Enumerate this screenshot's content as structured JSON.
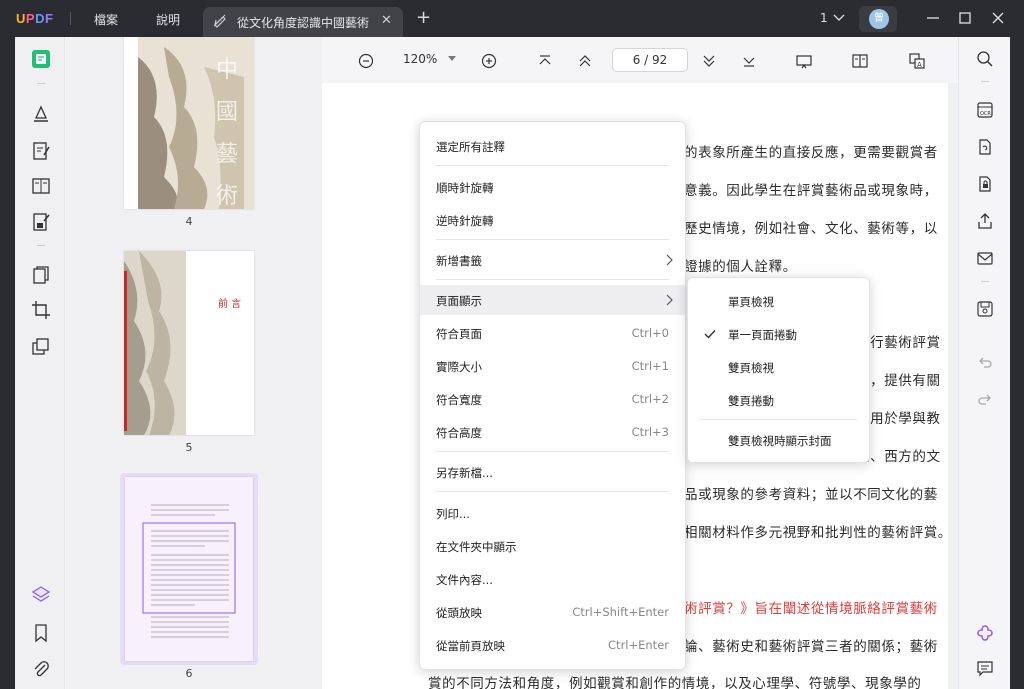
{
  "app": {
    "logo": [
      "U",
      "P",
      "D",
      "F"
    ]
  },
  "menubar": {
    "file": "檔案",
    "help": "說明"
  },
  "tab": {
    "title": "從文化角度認識中國藝術"
  },
  "window": {
    "count": "1",
    "avatar": "曾"
  },
  "toolbar": {
    "zoom": "120%",
    "page_current": "6",
    "page_total": "92",
    "page_display": "6  /  92"
  },
  "thumbnails": [
    {
      "page": "4",
      "title_text": "中國藝術"
    },
    {
      "page": "5",
      "title_text": "前言"
    },
    {
      "page": "6"
    }
  ],
  "document": {
    "lines": [
      {
        "text": "的表象所產生的直接反應，更需要觀賞者",
        "color": "#2b2b2b"
      },
      {
        "text": "意義。因此學生在評賞藝術品或現象時，",
        "color": "#2b2b2b"
      },
      {
        "text": "歷史情境，例如社會、文化、藝術等，以",
        "color": "#2b2b2b"
      },
      {
        "text": "證據的個人詮釋。",
        "color": "#2b2b2b"
      },
      {
        "text": "進行藝術評賞",
        "color": "#2b2b2b"
      },
      {
        "text": "文，提供有關",
        "color": "#2b2b2b"
      },
      {
        "text": "運用於學與教",
        "color": "#2b2b2b"
      },
      {
        "text": "地、西方的文",
        "color": "#2b2b2b"
      },
      {
        "text": "品或現象的參考資料；並以不同文化的藝",
        "color": "#2b2b2b"
      },
      {
        "text": "相關材料作多元視野和批判性的藝術評賞。",
        "color": "#2b2b2b"
      },
      {
        "text": "術評賞？》旨在闡述從情境脈絡評賞藝術",
        "color": "#e23b3b"
      },
      {
        "text": "論、藝術史和藝術評賞三者的關係；藝術",
        "color": "#2b2b2b"
      },
      {
        "text": "賞的不同方法和角度，例如觀賞和創作的情境，以及心理學、符號學、現象學的",
        "color": "#2b2b2b"
      }
    ]
  },
  "context_menu": {
    "items": [
      {
        "label": "選定所有註釋",
        "shortcut": ""
      },
      {
        "label": "順時針旋轉",
        "shortcut": ""
      },
      {
        "label": "逆時針旋轉",
        "shortcut": ""
      },
      {
        "label": "新增書籤",
        "shortcut": ""
      },
      {
        "label": "頁面顯示",
        "shortcut": ""
      },
      {
        "label": "符合頁面",
        "shortcut": "Ctrl+0"
      },
      {
        "label": "實際大小",
        "shortcut": "Ctrl+1"
      },
      {
        "label": "符合寬度",
        "shortcut": "Ctrl+2"
      },
      {
        "label": "符合高度",
        "shortcut": "Ctrl+3"
      },
      {
        "label": "另存新檔...",
        "shortcut": ""
      },
      {
        "label": "列印...",
        "shortcut": ""
      },
      {
        "label": "在文件夾中顯示",
        "shortcut": ""
      },
      {
        "label": "文件內容...",
        "shortcut": ""
      },
      {
        "label": "從頭放映",
        "shortcut": "Ctrl+Shift+Enter"
      },
      {
        "label": "從當前頁放映",
        "shortcut": "Ctrl+Enter"
      }
    ]
  },
  "submenu": {
    "items": [
      {
        "label": "單頁檢視",
        "checked": false
      },
      {
        "label": "單一頁面捲動",
        "checked": true
      },
      {
        "label": "雙頁檢視",
        "checked": false
      },
      {
        "label": "雙頁捲動",
        "checked": false
      },
      {
        "label": "雙頁檢視時顯示封面",
        "checked": false
      }
    ]
  },
  "colors": {
    "accent": "#1fbf75",
    "highlight_red": "#e23b3b",
    "selection": "#e6dcf8"
  }
}
